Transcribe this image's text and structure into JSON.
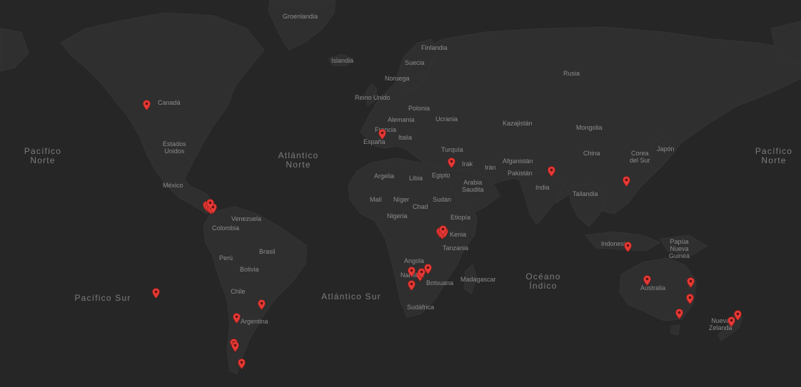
{
  "map": {
    "colors": {
      "background": "#262626",
      "land": "#2f2f2f",
      "label": "#8c8c8c",
      "marker": "#e53935"
    },
    "oceans": {
      "pacific_north_left": [
        "Pacífico",
        "Norte"
      ],
      "atlantic_north": [
        "Atlántico",
        "Norte"
      ],
      "pacific_north_right": [
        "Pacífico",
        "Norte"
      ],
      "pacific_south": "Pacífico Sur",
      "atlantic_south": "Atlántico Sur",
      "indian": [
        "Océano",
        "Índico"
      ]
    },
    "countries": {
      "groenlandia": "Groenlandia",
      "islandia": "Islandia",
      "finlandia": "Finlandia",
      "suecia": "Suecia",
      "noruega": "Noruega",
      "rusia": "Rusia",
      "reino_unido": "Reino Unido",
      "polonia": "Polonia",
      "alemania": "Alemania",
      "ucrania": "Ucrania",
      "francia": "Francia",
      "espana": "España",
      "italia": "Italia",
      "kazajistan": "Kazajistán",
      "mongolia": "Mongolia",
      "canada": "Canadá",
      "estados_unidos": [
        "Estados",
        "Unidos"
      ],
      "mexico": "México",
      "venezuela": "Venezuela",
      "colombia": "Colombia",
      "peru": "Perú",
      "brasil": "Brasil",
      "bolivia": "Bolivia",
      "chile": "Chile",
      "argentina": "Argentina",
      "turquia": "Turquía",
      "irak": "Irak",
      "iran": "Irán",
      "afganistan": "Afganistán",
      "pakistan": "Pakistán",
      "china": "China",
      "corea_del_sur": [
        "Corea",
        "del Sur"
      ],
      "japon": "Japón",
      "argelia": "Argelia",
      "libia": "Libia",
      "egipto": "Egipto",
      "arabia_saudita": [
        "Arabia",
        "Saudita"
      ],
      "india": "India",
      "tailandia": "Tailandia",
      "mali": "Malí",
      "niger": "Níger",
      "chad": "Chad",
      "sudan": "Sudán",
      "nigeria": "Nigeria",
      "etiopia": "Etiopía",
      "kenia": "Kenia",
      "tanzania": "Tanzania",
      "angola": "Angola",
      "namibia": "Namibia",
      "botsuana": "Botsuana",
      "madagascar": "Madagascar",
      "sudafrica": "Sudáfrica",
      "indonesia": "Indonesia",
      "papua_nueva_guinea": [
        "Papúa",
        "Nueva",
        "Guinea"
      ],
      "australia": "Australia",
      "nueva_zelanda": [
        "Nueva",
        "Zelanda"
      ]
    },
    "marker_count": 32
  }
}
